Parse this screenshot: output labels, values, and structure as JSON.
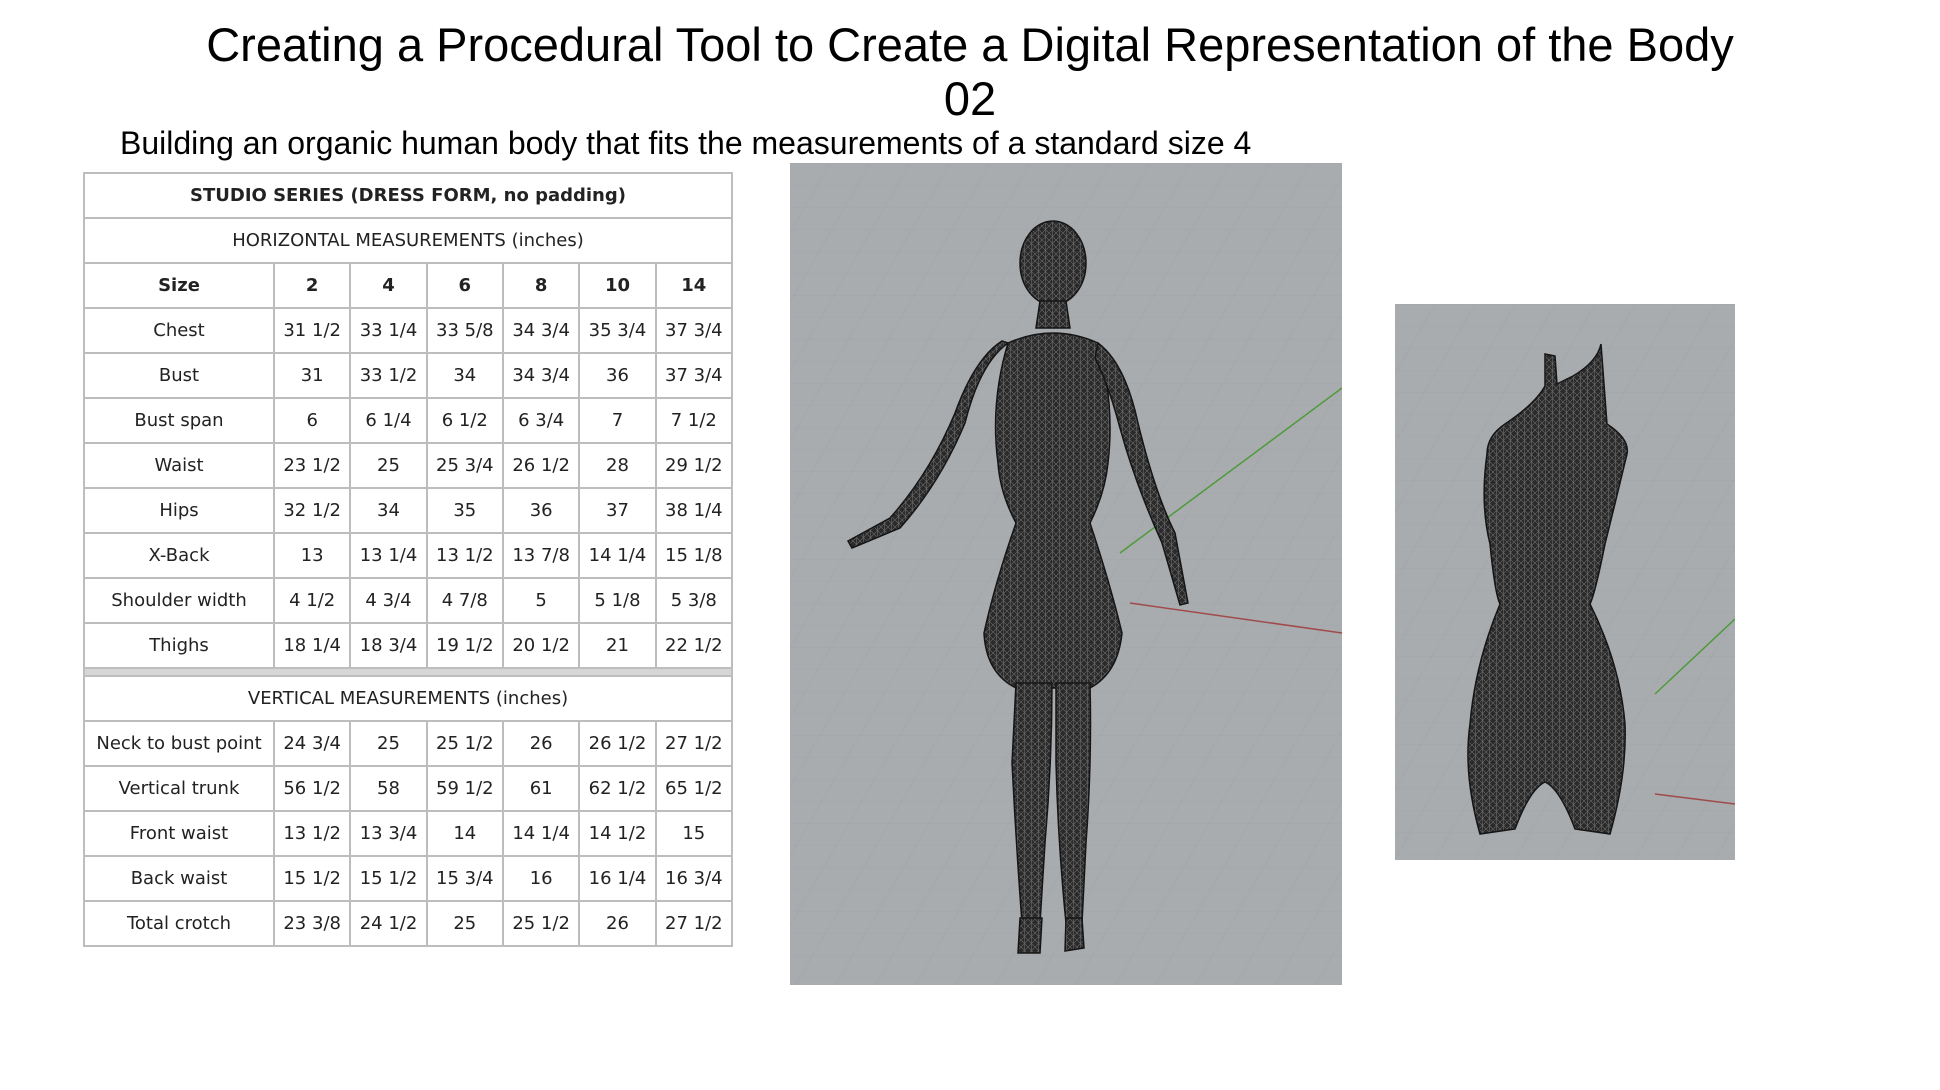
{
  "slide": {
    "title_line1": "Creating a Procedural Tool to Create a Digital Representation of the Body",
    "title_line2": "02",
    "subtitle": "Building an organic human body that fits the measurements of a standard size 4"
  },
  "table": {
    "header": "STUDIO SERIES (DRESS FORM, no padding)",
    "horizontal_title": "HORIZONTAL MEASUREMENTS (inches)",
    "size_label": "Size",
    "sizes": [
      "2",
      "4",
      "6",
      "8",
      "10",
      "14"
    ],
    "horizontal_rows": [
      {
        "label": "Chest",
        "values": [
          "31 1/2",
          "33 1/4",
          "33 5/8",
          "34 3/4",
          "35 3/4",
          "37 3/4"
        ]
      },
      {
        "label": "Bust",
        "values": [
          "31",
          "33 1/2",
          "34",
          "34 3/4",
          "36",
          "37 3/4"
        ]
      },
      {
        "label": "Bust span",
        "values": [
          "6",
          "6 1/4",
          "6 1/2",
          "6 3/4",
          "7",
          "7 1/2"
        ]
      },
      {
        "label": "Waist",
        "values": [
          "23 1/2",
          "25",
          "25 3/4",
          "26 1/2",
          "28",
          "29 1/2"
        ]
      },
      {
        "label": "Hips",
        "values": [
          "32 1/2",
          "34",
          "35",
          "36",
          "37",
          "38 1/4"
        ]
      },
      {
        "label": "X-Back",
        "values": [
          "13",
          "13 1/4",
          "13 1/2",
          "13 7/8",
          "14 1/4",
          "15 1/8"
        ]
      },
      {
        "label": "Shoulder width",
        "values": [
          "4 1/2",
          "4 3/4",
          "4 7/8",
          "5",
          "5 1/8",
          "5 3/8"
        ]
      },
      {
        "label": "Thighs",
        "values": [
          "18 1/4",
          "18 3/4",
          "19 1/2",
          "20 1/2",
          "21",
          "22 1/2"
        ]
      }
    ],
    "vertical_title": "VERTICAL MEASUREMENTS (inches)",
    "vertical_rows": [
      {
        "label": "Neck to bust point",
        "values": [
          "24 3/4",
          "25",
          "25 1/2",
          "26",
          "26 1/2",
          "27 1/2"
        ]
      },
      {
        "label": "Vertical trunk",
        "values": [
          "56 1/2",
          "58",
          "59 1/2",
          "61",
          "62 1/2",
          "65 1/2"
        ]
      },
      {
        "label": "Front waist",
        "values": [
          "13 1/2",
          "13 3/4",
          "14",
          "14 1/4",
          "14 1/2",
          "15"
        ]
      },
      {
        "label": "Back waist",
        "values": [
          "15 1/2",
          "15 1/2",
          "15 3/4",
          "16",
          "16 1/4",
          "16 3/4"
        ]
      },
      {
        "label": "Total crotch",
        "values": [
          "23 3/8",
          "24 1/2",
          "25",
          "25 1/2",
          "26",
          "27 1/2"
        ]
      }
    ]
  },
  "images": {
    "full_body": "wireframe-full-body-render",
    "torso": "wireframe-dress-form-torso-render"
  },
  "colors": {
    "viewport_bg": "#a9acaf",
    "grid_line": "#9a9da0",
    "axis_green": "#4e9a3a",
    "axis_red": "#a04a4a",
    "mesh_dark": "#1c1c1c"
  }
}
